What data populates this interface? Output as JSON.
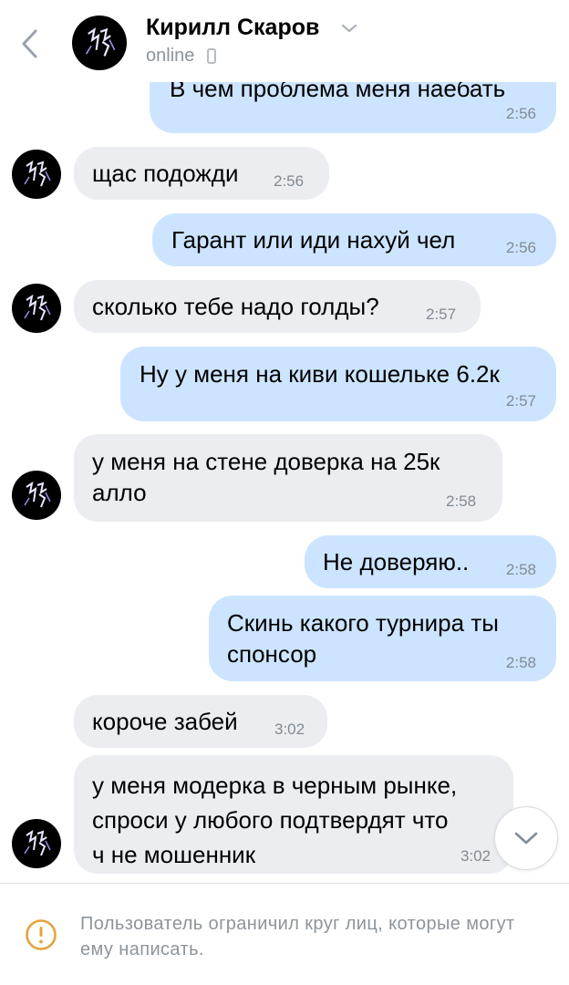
{
  "header": {
    "contact_name": "Кирилл Скаров",
    "status": "online",
    "back_icon": "chevron-left-icon",
    "name_menu_icon": "chevron-down-icon",
    "device_icon": "phone-icon"
  },
  "messages": [
    {
      "dir": "out",
      "text": "В чем проблема меня наебать",
      "time": "2:56"
    },
    {
      "dir": "in",
      "text": "щас подожди",
      "time": "2:56"
    },
    {
      "dir": "out",
      "text": "Гарант или иди нахуй чел",
      "time": "2:56"
    },
    {
      "dir": "in",
      "text": "сколько тебе надо голды?",
      "time": "2:57"
    },
    {
      "dir": "out",
      "text": "Ну у меня на киви кошельке 6.2к",
      "time": "2:57"
    },
    {
      "dir": "in",
      "text": "у меня на стене доверка на 25к\nалло",
      "time": "2:58"
    },
    {
      "dir": "out",
      "text": "Не доверяю..",
      "time": "2:58"
    },
    {
      "dir": "out",
      "text": "Скинь какого турнира ты\nспонсор",
      "time": "2:58"
    },
    {
      "dir": "in",
      "text": "короче забей",
      "time": "3:02"
    },
    {
      "dir": "in",
      "text": "у меня модерка в черным рынке,\nспроси у любого подтвердят что\nч не мошенник",
      "time": "3:02"
    }
  ],
  "footer": {
    "notice": "Пользователь ограничил круг лиц, которые могут ему написать.",
    "notice_icon": "warning-circle-icon"
  },
  "scroll_button_icon": "chevron-down-icon",
  "colors": {
    "outgoing_bubble": "#cce4ff",
    "incoming_bubble": "#ebedf0",
    "warning": "#e6a23c",
    "accent": "#8d949c"
  }
}
